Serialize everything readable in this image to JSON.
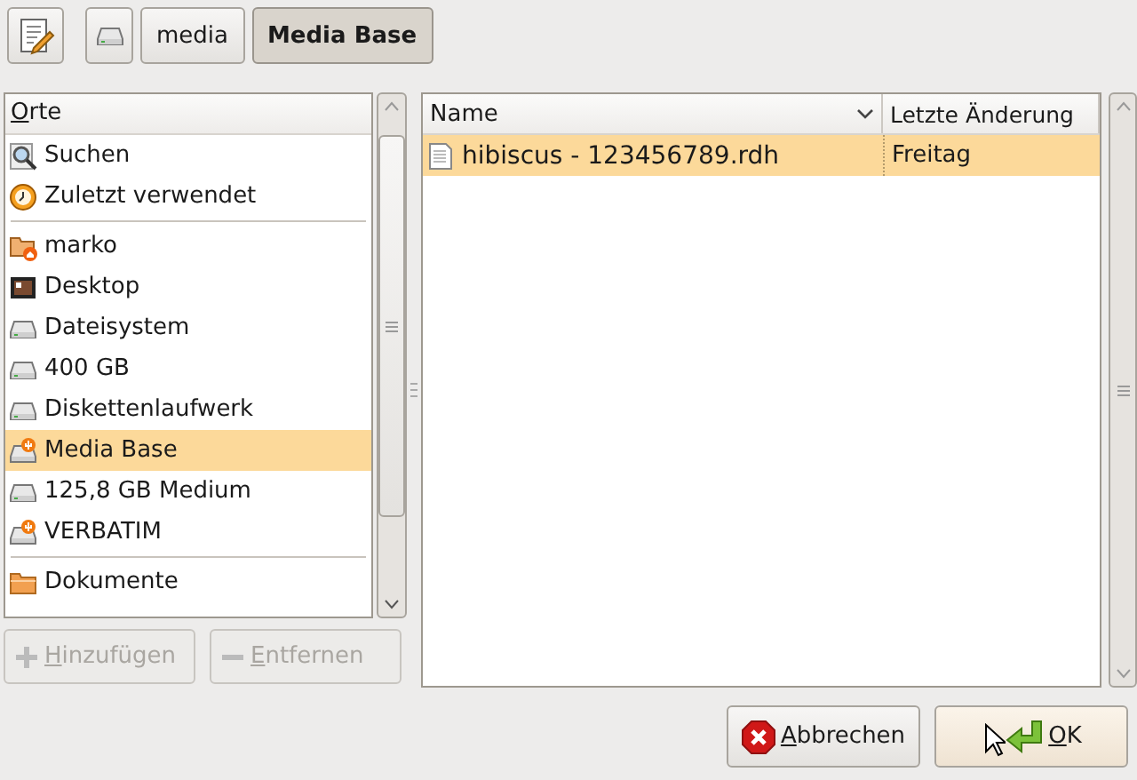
{
  "path_bar": [
    {
      "kind": "drive",
      "selected": false
    },
    {
      "kind": "folder",
      "label": "media",
      "selected": false
    },
    {
      "kind": "folder",
      "label": "Media Base",
      "selected": true
    }
  ],
  "places": {
    "header": "Orte",
    "groups": [
      [
        {
          "kind": "search",
          "label": "Suchen",
          "selected": false
        },
        {
          "kind": "recent",
          "label": "Zuletzt verwendet",
          "selected": false
        }
      ],
      [
        {
          "kind": "home",
          "label": "marko",
          "selected": false
        },
        {
          "kind": "desktop",
          "label": "Desktop",
          "selected": false
        },
        {
          "kind": "drive",
          "label": "Dateisystem",
          "selected": false
        },
        {
          "kind": "drive",
          "label": "400 GB",
          "selected": false
        },
        {
          "kind": "drive",
          "label": "Diskettenlaufwerk",
          "selected": false
        },
        {
          "kind": "usb",
          "label": "Media Base",
          "selected": true
        },
        {
          "kind": "drive",
          "label": "125,8 GB Medium",
          "selected": false
        },
        {
          "kind": "usb",
          "label": "VERBATIM",
          "selected": false
        }
      ],
      [
        {
          "kind": "folder",
          "label": "Dokumente",
          "selected": false
        }
      ]
    ]
  },
  "place_buttons": [
    {
      "kind": "add",
      "label": "Hinzufügen",
      "disabled": true
    },
    {
      "kind": "remove",
      "label": "Entfernen",
      "disabled": true
    }
  ],
  "files": {
    "columns": [
      {
        "label": "Name",
        "sorted": true
      },
      {
        "label": "Letzte Änderung",
        "sorted": false
      }
    ],
    "rows": [
      {
        "name": "hibiscus - 123456789.rdh",
        "modified": "Freitag",
        "selected": true
      }
    ]
  },
  "dialog_buttons": [
    {
      "kind": "cancel",
      "label": "Abbrechen"
    },
    {
      "kind": "ok",
      "label": "OK"
    }
  ]
}
